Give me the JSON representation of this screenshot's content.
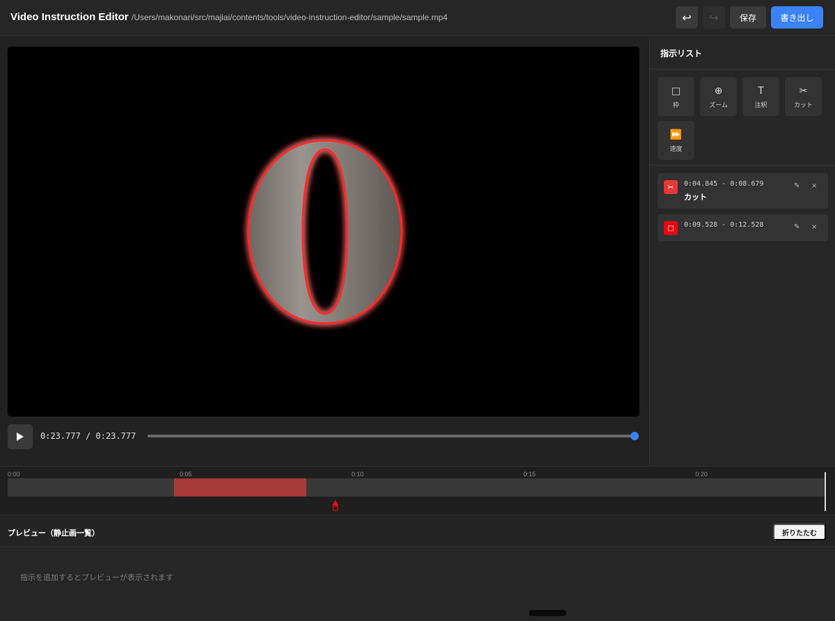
{
  "header": {
    "title": "Video Instruction Editor",
    "file_path": "/Users/makonari/src/majiai/contents/tools/video-instruction-editor/sample/sample.mp4",
    "undo_icon": "↩",
    "redo_icon": "↪",
    "save_label": "保存",
    "export_label": "書き出し",
    "export_color": "#3b82f6"
  },
  "player": {
    "play_icon": "play-icon",
    "current_time": "0:23.777",
    "separator": "/",
    "duration": "0:23.777",
    "progress_fraction": 1.0,
    "video_glyph": "0"
  },
  "sidebar": {
    "title": "指示リスト",
    "tools": [
      {
        "icon": "□",
        "label": "枠"
      },
      {
        "icon": "⊕",
        "label": "ズーム"
      },
      {
        "icon": "T",
        "label": "注釈"
      },
      {
        "icon": "✂",
        "label": "カット"
      },
      {
        "icon": "⏩",
        "label": "速度"
      }
    ],
    "instructions": [
      {
        "type": "cut",
        "icon": "✂",
        "color": "#e53935",
        "time_range": "0:04.845 - 0:08.679",
        "label": "カット"
      },
      {
        "type": "frame",
        "icon": "□",
        "color": "#e50914",
        "time_range": "0:09.528 - 0:12.528",
        "label": ""
      }
    ],
    "edit_icon": "✎",
    "delete_icon": "×"
  },
  "timeline": {
    "ticks": [
      "0:00",
      "0:05",
      "0:10",
      "0:15",
      "0:20"
    ],
    "duration_seconds": 23.777,
    "cut_segment": {
      "start": 4.845,
      "end": 8.679,
      "color": "#a83a38"
    },
    "frame_marker": {
      "time": 9.528,
      "color": "#e50914"
    }
  },
  "preview": {
    "title": "プレビュー（静止画一覧）",
    "collapse_label": "折りたたむ",
    "empty_message": "指示を追加するとプレビューが表示されます"
  }
}
